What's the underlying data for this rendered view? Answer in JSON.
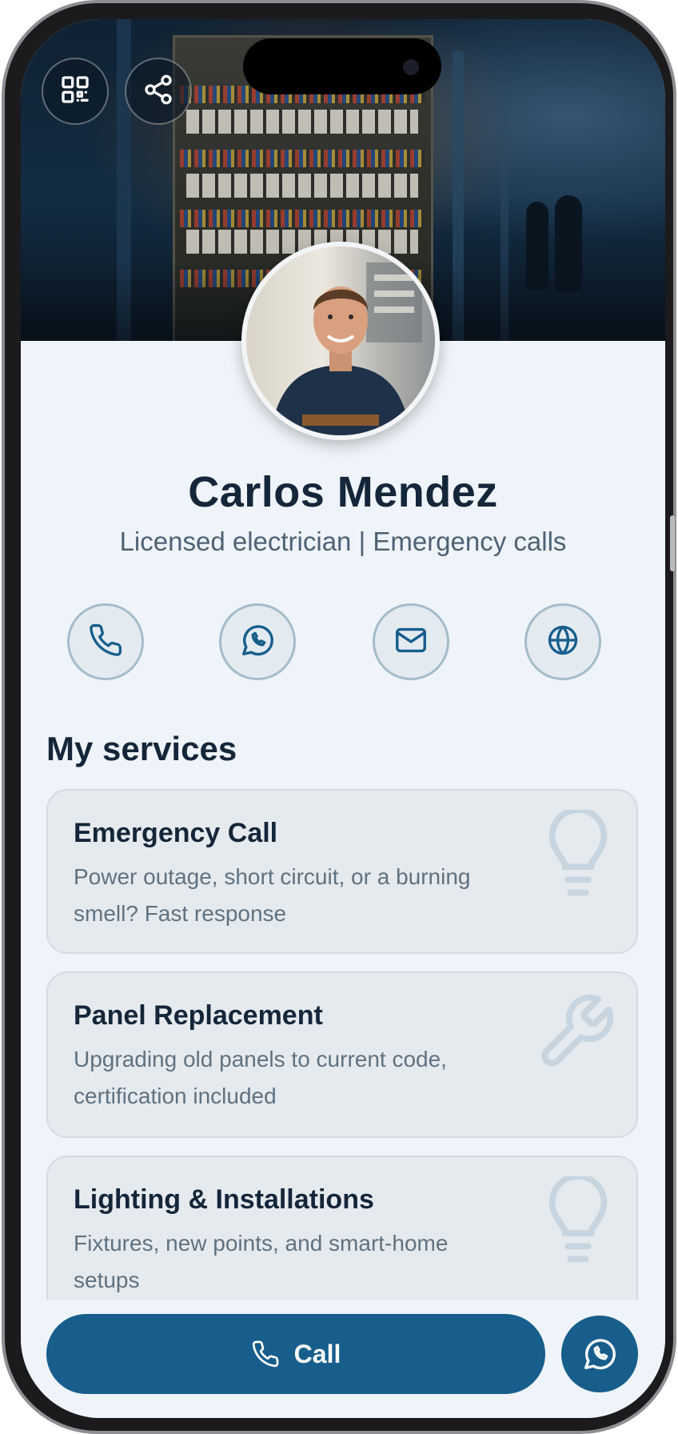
{
  "profile": {
    "name": "Carlos Mendez",
    "tagline": "Licensed electrician | Emergency calls"
  },
  "header_actions": [
    {
      "icon": "qr-code-icon"
    },
    {
      "icon": "share-icon"
    }
  ],
  "contact_actions": [
    {
      "icon": "phone-icon"
    },
    {
      "icon": "whatsapp-icon"
    },
    {
      "icon": "mail-icon"
    },
    {
      "icon": "globe-icon"
    }
  ],
  "services": {
    "title": "My services",
    "items": [
      {
        "title": "Emergency Call",
        "description": "Power outage, short circuit, or a burning smell? Fast response",
        "icon": "lightbulb-icon"
      },
      {
        "title": "Panel Replacement",
        "description": "Upgrading old panels to current code, certification included",
        "icon": "wrench-icon"
      },
      {
        "title": "Lighting & Installations",
        "description": "Fixtures, new points, and smart-home setups",
        "icon": "lightbulb-icon"
      }
    ]
  },
  "cta": {
    "call_label": "Call"
  },
  "colors": {
    "primary": "#175e8c",
    "heading": "#14263a",
    "background": "#eef4f9",
    "card": "#e5eaee"
  }
}
